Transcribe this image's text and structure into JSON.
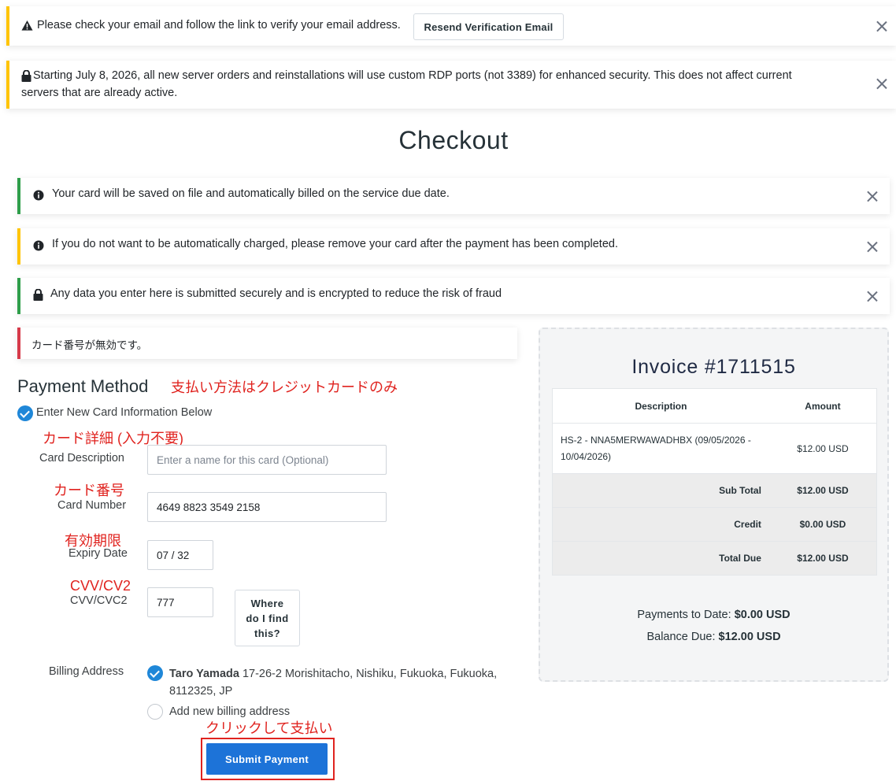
{
  "notifications": {
    "verify_email": {
      "message": "Please check your email and follow the link to verify your email address.",
      "button_label": "Resend Verification Email",
      "icon": "warning-icon"
    },
    "rdp_notice": {
      "message_line1": "Starting July 8, 2026, all new server orders and reinstallations will use custom RDP ports (not 3389) for enhanced security. This does not affect current",
      "message_line2": "servers that are already active.",
      "icon": "lock-icon"
    }
  },
  "page": {
    "title": "Checkout"
  },
  "alerts": [
    {
      "text": "Your card will be saved on file and automatically billed on the service due date.",
      "icon": "info-icon",
      "color": "#2e9e4a"
    },
    {
      "text": "If you do not want to be automatically charged, please remove your card after the payment has been completed.",
      "icon": "info-icon",
      "color": "#ffc400"
    },
    {
      "text": "Any data you enter here is submitted securely and is encrypted to reduce the risk of fraud",
      "icon": "lock-icon",
      "color": "#2e9e4a"
    }
  ],
  "error_alert": {
    "text": "カード番号が無効です。",
    "color": "#d63a4a"
  },
  "payment": {
    "heading": "Payment Method",
    "annotation_method": "支払い方法はクレジットカードのみ",
    "new_card_option": "Enter New Card Information Below",
    "card_description": {
      "annotation": "カード詳細 (入力不要)",
      "label": "Card Description",
      "placeholder": "Enter a name for this card (Optional)"
    },
    "card_number": {
      "annotation": "カード番号",
      "label": "Card Number",
      "value": "4649 8823 3549 2158"
    },
    "expiry": {
      "annotation": "有効期限",
      "label": "Expiry Date",
      "value": "07 / 32"
    },
    "cvv": {
      "annotation": "CVV/CV2",
      "label": "CVV/CVC2",
      "value": "777",
      "help_button_line1": "Where",
      "help_button_line2": "do I find",
      "help_button_line3": "this?"
    },
    "billing": {
      "label": "Billing Address",
      "name": "Taro Yamada",
      "address_line1": "17-26-2 Morishitacho, Nishiku, Fukuoka, Fukuoka,",
      "address_line2": "8112325, JP",
      "new_address_option": "Add new billing address"
    },
    "submit_annotation": "クリックして支払い",
    "submit_label": "Submit Payment",
    "accent_color": "#1d73d8",
    "annotation_color": "#e0231f"
  },
  "invoice": {
    "title": "Invoice #1711515",
    "columns": [
      "Description",
      "Amount"
    ],
    "item": {
      "description_line1": "HS-2 - NNA5MERWAWADHBX (09/05/2026 -",
      "description_line2": "10/04/2026)",
      "amount": "$12.00 USD"
    },
    "sub_total_label": "Sub Total",
    "sub_total": "$12.00 USD",
    "credit_label": "Credit",
    "credit": "$0.00 USD",
    "total_due_label": "Total Due",
    "total_due": "$12.00 USD",
    "payments_to_date_label": "Payments to Date:",
    "payments_to_date": "$0.00 USD",
    "balance_due_label": "Balance Due:",
    "balance_due": "$12.00 USD"
  }
}
